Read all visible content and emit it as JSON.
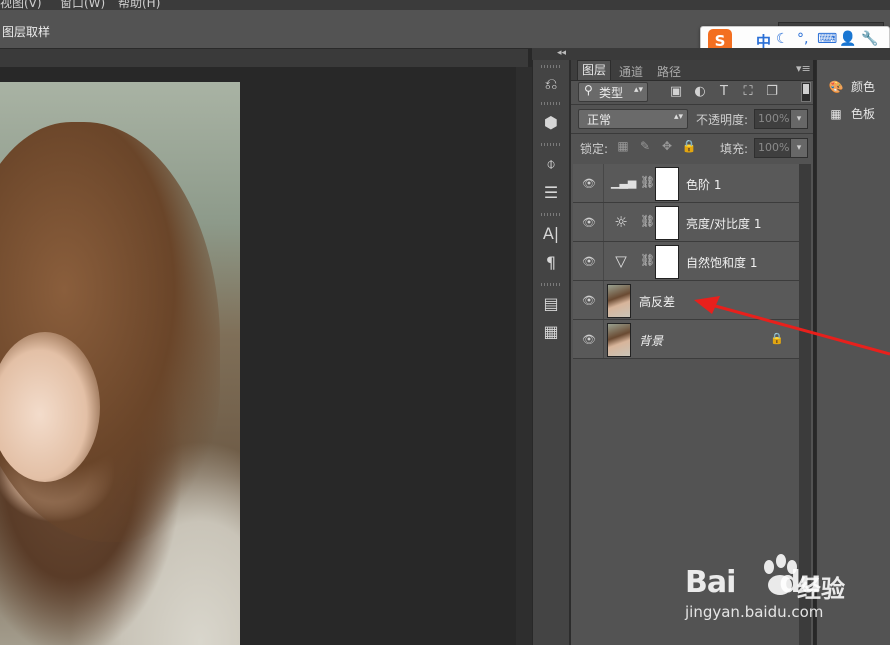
{
  "menubar": {
    "items": [
      "视图(V)",
      "窗口(W)",
      "帮助(H)"
    ]
  },
  "options_bar": {
    "label": "图层取样"
  },
  "ime": {
    "logo": "S",
    "lang": "中",
    "icons": [
      "moon-icon",
      "punctuation-icon",
      "keyboard-icon",
      "user-icon",
      "wrench-icon"
    ]
  },
  "collapse": {
    "arrows": "◂◂"
  },
  "layers_panel": {
    "tabs": [
      "图层",
      "通道",
      "路径"
    ],
    "filter_kind": "类型",
    "blend_mode": "正常",
    "opacity_label": "不透明度:",
    "opacity_value": "100%",
    "lock_label": "锁定:",
    "fill_label": "填充:",
    "fill_value": "100%",
    "layers": [
      {
        "name": "色阶 1",
        "type": "adjustment",
        "icon": "levels-icon"
      },
      {
        "name": "亮度/对比度 1",
        "type": "adjustment",
        "icon": "brightness-icon"
      },
      {
        "name": "自然饱和度 1",
        "type": "adjustment",
        "icon": "vibrance-icon"
      },
      {
        "name": "高反差",
        "type": "pixel",
        "selected": true
      },
      {
        "name": "背景",
        "type": "background",
        "locked": true
      }
    ]
  },
  "mini_panel": {
    "items": [
      "颜色",
      "色板"
    ]
  },
  "watermark": {
    "brand": "Bai",
    "brand_suffix": "du",
    "jingyan": "经验",
    "url": "jingyan.baidu.com"
  },
  "colors": {
    "ime_blue": "#2a6fd6",
    "ime_orange": "#f36f21",
    "arrow_red": "#e8201c",
    "panel_bg": "#535353"
  }
}
